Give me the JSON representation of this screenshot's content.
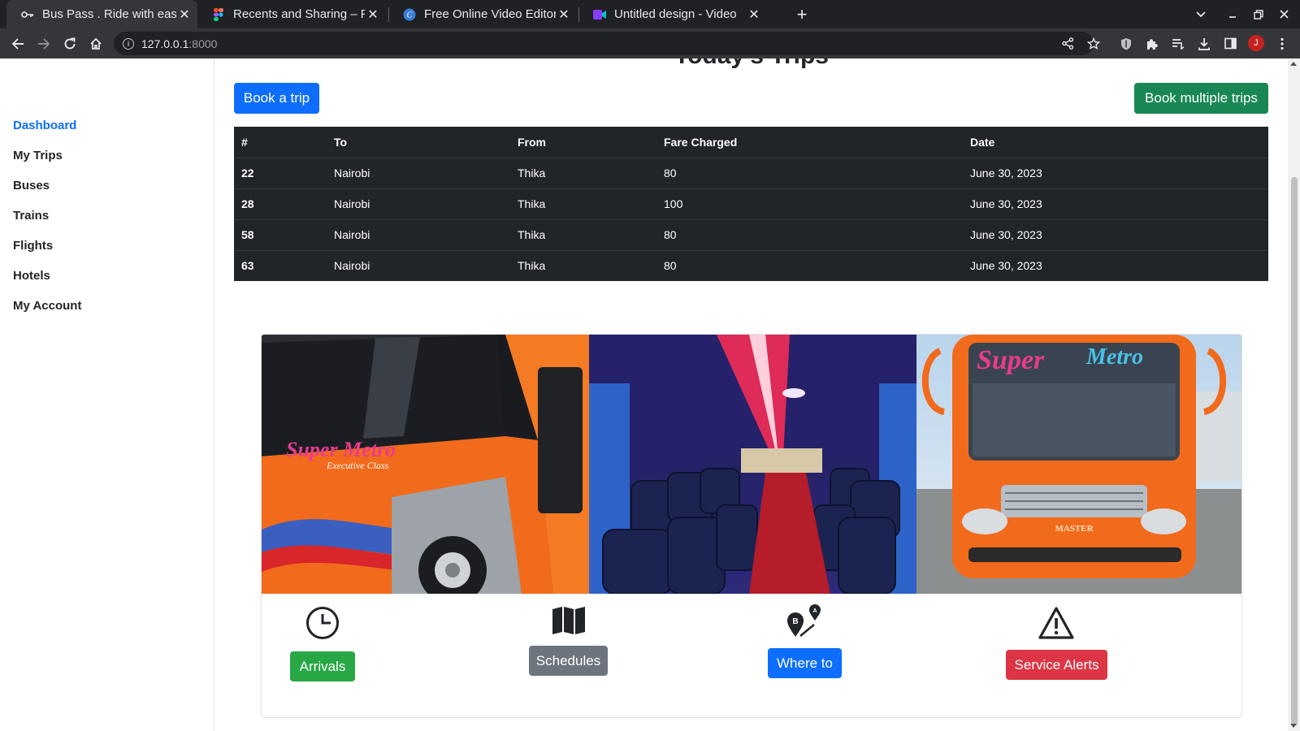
{
  "browser": {
    "tabs": [
      {
        "title": "Bus Pass . Ride with ease",
        "icon": "key-icon",
        "active": true
      },
      {
        "title": "Recents and Sharing – Figma",
        "icon": "figma-icon",
        "active": false
      },
      {
        "title": "Free Online Video Editor & Maker",
        "icon": "canva-icon",
        "active": false
      },
      {
        "title": "Untitled design - Video",
        "icon": "video-icon",
        "active": false
      }
    ],
    "address": {
      "host": "127.0.0.1",
      "port": ":8000"
    },
    "avatar_initial": "J"
  },
  "sidebar": {
    "items": [
      {
        "label": "Dashboard",
        "active": true
      },
      {
        "label": "My Trips",
        "active": false
      },
      {
        "label": "Buses",
        "active": false
      },
      {
        "label": "Trains",
        "active": false
      },
      {
        "label": "Flights",
        "active": false
      },
      {
        "label": "Hotels",
        "active": false
      },
      {
        "label": "My Account",
        "active": false
      }
    ]
  },
  "main": {
    "title": "Today's Trips",
    "book_trip_label": "Book a trip",
    "book_multiple_label": "Book multiple trips",
    "table": {
      "headers": [
        "#",
        "To",
        "From",
        "Fare Charged",
        "Date"
      ],
      "rows": [
        [
          "22",
          "Nairobi",
          "Thika",
          "80",
          "June 30, 2023"
        ],
        [
          "28",
          "Nairobi",
          "Thika",
          "100",
          "June 30, 2023"
        ],
        [
          "58",
          "Nairobi",
          "Thika",
          "80",
          "June 30, 2023"
        ],
        [
          "63",
          "Nairobi",
          "Thika",
          "80",
          "June 30, 2023"
        ]
      ]
    },
    "banner_text": {
      "left": "Super Metro",
      "left_sub": "Executive Class",
      "right_1": "Super",
      "right_2": "Metro",
      "grille": "MASTER"
    },
    "features": [
      {
        "label": "Arrivals",
        "icon": "clock-icon"
      },
      {
        "label": "Schedules",
        "icon": "map-icon"
      },
      {
        "label": "Where to",
        "icon": "route-icon"
      },
      {
        "label": "Service Alerts",
        "icon": "warning-icon"
      }
    ],
    "route_marks": {
      "start": "B",
      "end": "A"
    }
  },
  "colors": {
    "primary": "#0d6efd",
    "success": "#198754",
    "secondary": "#6c757d",
    "danger": "#dc3545",
    "table_dark": "#212529",
    "bus_orange": "#f26a1b"
  }
}
